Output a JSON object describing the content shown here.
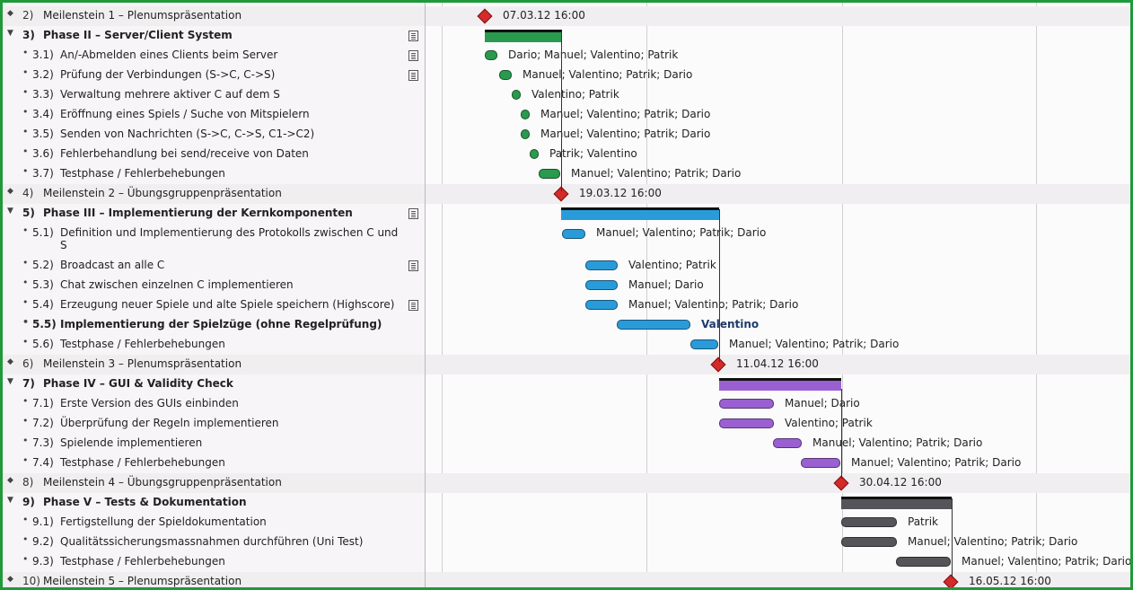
{
  "colors": {
    "frame": "#1f9a3a",
    "phase2": "#2a9a4e",
    "phase3": "#2a9bd9",
    "phase4": "#9a60d2",
    "phase5": "#555559",
    "milestone": "#d42a2a"
  },
  "rows": [
    {
      "num": "2)",
      "title": "Meilenstein 1 – Plenumspräsentation",
      "level": 0,
      "type": "milestone",
      "note": false,
      "chart_label": "07.03.12 16:00"
    },
    {
      "num": "3)",
      "title": "Phase II – Server/Client System",
      "level": 0,
      "type": "phase",
      "note": true,
      "chart_label": ""
    },
    {
      "num": "3.1)",
      "title": "An/-Abmelden eines Clients beim Server",
      "level": 1,
      "type": "task",
      "note": true,
      "chart_label": "Dario; Manuel; Valentino; Patrik"
    },
    {
      "num": "3.2)",
      "title": "Prüfung der Verbindungen (S->C, C->S)",
      "level": 1,
      "type": "task",
      "note": true,
      "chart_label": "Manuel; Valentino; Patrik; Dario"
    },
    {
      "num": "3.3)",
      "title": "Verwaltung mehrere aktiver C auf dem S",
      "level": 1,
      "type": "task",
      "note": false,
      "chart_label": "Valentino; Patrik"
    },
    {
      "num": "3.4)",
      "title": "Eröffnung eines Spiels / Suche von Mitspielern",
      "level": 1,
      "type": "task",
      "note": false,
      "chart_label": "Manuel; Valentino; Patrik; Dario"
    },
    {
      "num": "3.5)",
      "title": "Senden von Nachrichten (S->C, C->S, C1->C2)",
      "level": 1,
      "type": "task",
      "note": false,
      "chart_label": "Manuel; Valentino; Patrik; Dario"
    },
    {
      "num": "3.6)",
      "title": "Fehlerbehandlung bei send/receive von Daten",
      "level": 1,
      "type": "task",
      "note": false,
      "chart_label": "Patrik; Valentino"
    },
    {
      "num": "3.7)",
      "title": "Testphase / Fehlerbehebungen",
      "level": 1,
      "type": "task",
      "note": false,
      "chart_label": "Manuel; Valentino; Patrik; Dario"
    },
    {
      "num": "4)",
      "title": "Meilenstein 2 – Übungsgruppenpräsentation",
      "level": 0,
      "type": "milestone",
      "note": false,
      "chart_label": "19.03.12 16:00"
    },
    {
      "num": "5)",
      "title": "Phase III – Implementierung der Kernkomponenten",
      "level": 0,
      "type": "phase",
      "note": true,
      "chart_label": ""
    },
    {
      "num": "5.1)",
      "title": "Definition und Implementierung des Protokolls zwischen C und",
      "title2": "S",
      "level": 1,
      "type": "task",
      "note": false,
      "chart_label": "Manuel; Valentino; Patrik; Dario"
    },
    {
      "num": "5.2)",
      "title": "Broadcast an alle C",
      "level": 1,
      "type": "task",
      "note": true,
      "chart_label": "Valentino; Patrik"
    },
    {
      "num": "5.3)",
      "title": "Chat zwischen einzelnen C implementieren",
      "level": 1,
      "type": "task",
      "note": false,
      "chart_label": "Manuel; Dario"
    },
    {
      "num": "5.4)",
      "title": "Erzeugung neuer Spiele und alte Spiele speichern (Highscore)",
      "level": 1,
      "type": "task",
      "note": true,
      "chart_label": "Manuel; Valentino; Patrik; Dario"
    },
    {
      "num": "5.5)",
      "title": "Implementierung der Spielzüge (ohne Regelprüfung)",
      "level": 1,
      "type": "task",
      "bold": true,
      "note": false,
      "chart_label": "Valentino"
    },
    {
      "num": "5.6)",
      "title": "Testphase / Fehlerbehebungen",
      "level": 1,
      "type": "task",
      "note": false,
      "chart_label": "Manuel; Valentino; Patrik; Dario"
    },
    {
      "num": "6)",
      "title": "Meilenstein 3 – Plenumspräsentation",
      "level": 0,
      "type": "milestone",
      "note": false,
      "chart_label": "11.04.12 16:00"
    },
    {
      "num": "7)",
      "title": "Phase IV – GUI & Validity Check",
      "level": 0,
      "type": "phase",
      "note": false,
      "chart_label": ""
    },
    {
      "num": "7.1)",
      "title": "Erste Version des GUIs einbinden",
      "level": 1,
      "type": "task",
      "note": false,
      "chart_label": "Manuel; Dario"
    },
    {
      "num": "7.2)",
      "title": "Überprüfung der Regeln implementieren",
      "level": 1,
      "type": "task",
      "note": false,
      "chart_label": "Valentino; Patrik"
    },
    {
      "num": "7.3)",
      "title": "Spielende implementieren",
      "level": 1,
      "type": "task",
      "note": false,
      "chart_label": "Manuel; Valentino; Patrik; Dario"
    },
    {
      "num": "7.4)",
      "title": "Testphase / Fehlerbehebungen",
      "level": 1,
      "type": "task",
      "note": false,
      "chart_label": "Manuel; Valentino; Patrik; Dario"
    },
    {
      "num": "8)",
      "title": "Meilenstein 4 – Übungsgruppenpräsentation",
      "level": 0,
      "type": "milestone",
      "note": false,
      "chart_label": "30.04.12 16:00"
    },
    {
      "num": "9)",
      "title": "Phase V – Tests & Dokumentation",
      "level": 0,
      "type": "phase",
      "note": false,
      "chart_label": ""
    },
    {
      "num": "9.1)",
      "title": "Fertigstellung der Spieldokumentation",
      "level": 1,
      "type": "task",
      "note": false,
      "chart_label": "Patrik"
    },
    {
      "num": "9.2)",
      "title": "Qualitätssicherungsmassnahmen durchführen (Uni Test)",
      "level": 1,
      "type": "task",
      "note": false,
      "chart_label": "Manuel; Valentino; Patrik; Dario"
    },
    {
      "num": "9.3)",
      "title": "Testphase / Fehlerbehebungen",
      "level": 1,
      "type": "task",
      "note": false,
      "chart_label": "Manuel; Valentino; Patrik; Dario"
    },
    {
      "num": "10)",
      "title": "Meilenstein 5 – Plenumspräsentation",
      "level": 0,
      "type": "milestone",
      "note": false,
      "chart_label": "16.05.12 16:00"
    }
  ]
}
